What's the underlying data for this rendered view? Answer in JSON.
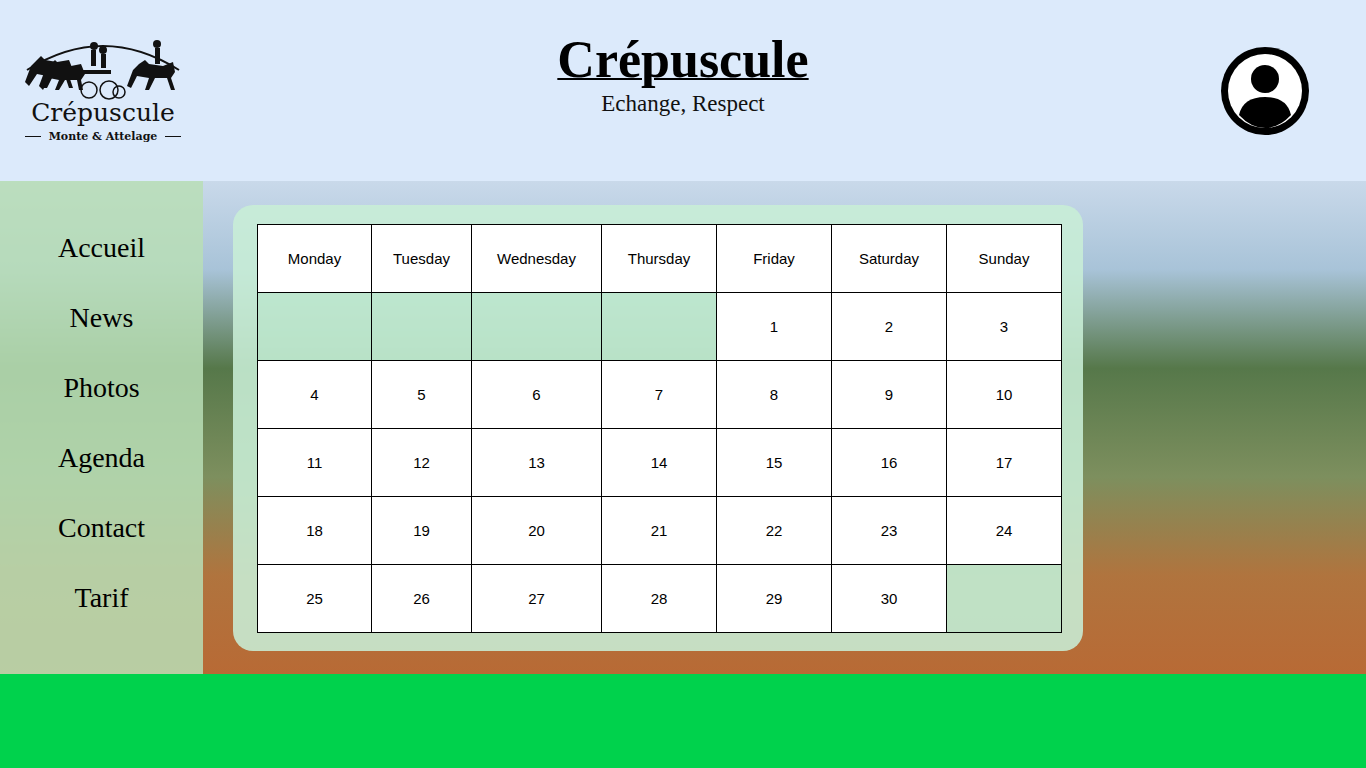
{
  "header": {
    "logo": {
      "name": "Crépuscule",
      "tagline": "Monte & Attelage"
    },
    "title": "Crépuscule",
    "subtitle": "Echange, Respect"
  },
  "sidebar": {
    "items": [
      {
        "label": "Accueil"
      },
      {
        "label": "News"
      },
      {
        "label": "Photos"
      },
      {
        "label": "Agenda"
      },
      {
        "label": "Contact"
      },
      {
        "label": "Tarif"
      }
    ]
  },
  "calendar": {
    "columns": [
      "Monday",
      "Tuesday",
      "Wednesday",
      "Thursday",
      "Friday",
      "Saturday",
      "Sunday"
    ],
    "weeks": [
      [
        "",
        "",
        "",
        "",
        "1",
        "2",
        "3"
      ],
      [
        "4",
        "5",
        "6",
        "7",
        "8",
        "9",
        "10"
      ],
      [
        "11",
        "12",
        "13",
        "14",
        "15",
        "16",
        "17"
      ],
      [
        "18",
        "19",
        "20",
        "21",
        "22",
        "23",
        "24"
      ],
      [
        "25",
        "26",
        "27",
        "28",
        "29",
        "30",
        ""
      ]
    ]
  }
}
